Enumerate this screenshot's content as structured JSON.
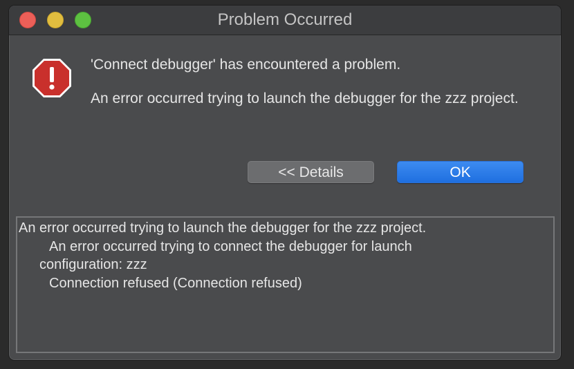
{
  "window": {
    "title": "Problem Occurred"
  },
  "dialog": {
    "icon": "error-stop-icon",
    "heading": "'Connect debugger' has encountered a problem.",
    "message": "An error occurred trying to launch the debugger for the zzz project.",
    "buttons": {
      "details_label": "<< Details",
      "ok_label": "OK"
    },
    "details": {
      "lines": [
        "An error occurred trying to launch the debugger for the zzz project.",
        "An error occurred trying to connect the debugger for launch",
        "configuration: zzz",
        "Connection refused (Connection refused)"
      ]
    }
  },
  "colors": {
    "window_bg": "#4a4b4d",
    "titlebar_bg": "#3c3d3f",
    "ok_button": "#1f6fe0",
    "close_light": "#ec5f58",
    "minimize_light": "#e1bd3f",
    "maximize_light": "#5dc041",
    "error_red": "#c9302c"
  }
}
